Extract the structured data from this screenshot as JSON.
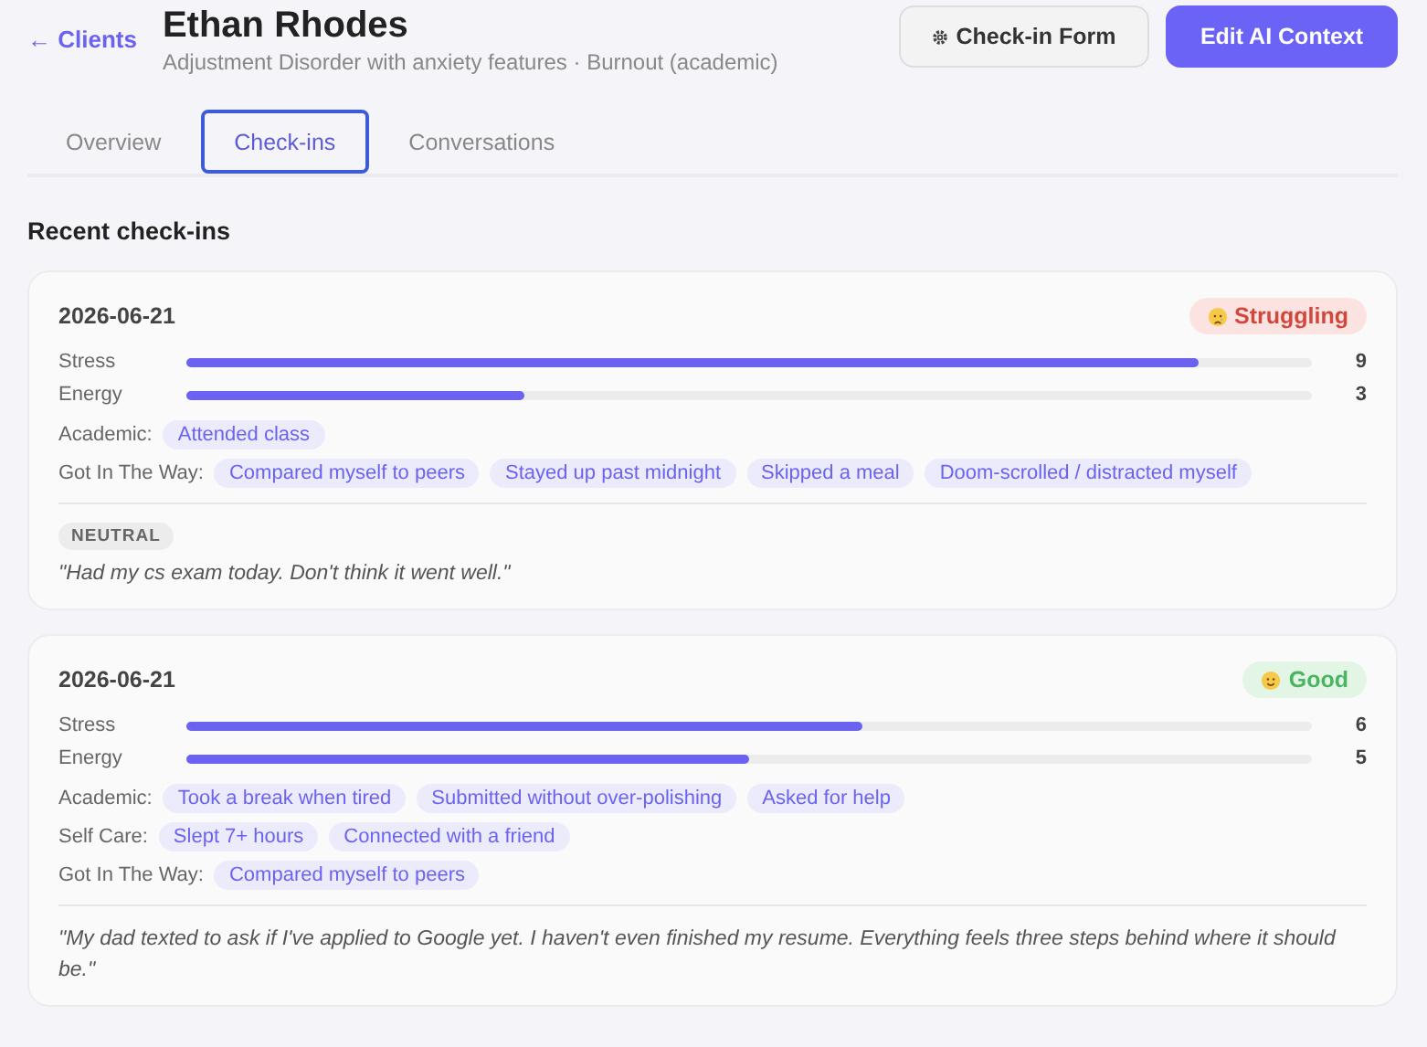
{
  "header": {
    "back_link": "← Clients",
    "client_name": "Ethan Rhodes",
    "subtitle": "Adjustment Disorder with anxiety features · Burnout (academic)",
    "buttons": [
      {
        "label": "Check-in Form",
        "kind": "secondary"
      },
      {
        "label": "Edit AI Context",
        "kind": "primary"
      }
    ]
  },
  "tabs": [
    {
      "label": "Overview",
      "selected": false
    },
    {
      "label": "Check-ins",
      "selected": true
    },
    {
      "label": "Conversations",
      "selected": false
    }
  ],
  "section_title": "Recent check-ins",
  "checkins": [
    {
      "date": "2026-06-21",
      "mood": {
        "label": "Struggling",
        "kind": "struggling"
      },
      "meters": [
        {
          "label": "Stress",
          "level": 0.9,
          "reading": "9"
        },
        {
          "label": "Energy",
          "level": 0.3,
          "reading": "3"
        }
      ],
      "tag_groups": [
        {
          "label": "Academic:",
          "tags": [
            "Attended class"
          ]
        },
        {
          "label": "Got In The Way:",
          "tags": [
            "Compared myself to peers",
            "Stayed up past midnight",
            "Skipped a meal",
            "Doom-scrolled / distracted myself"
          ]
        }
      ],
      "sentiment": "NEUTRAL",
      "note": "\"Had my cs exam today. Don't think it went well.\""
    },
    {
      "date": "2026-06-21",
      "mood": {
        "label": "Good",
        "kind": "good"
      },
      "meters": [
        {
          "label": "Stress",
          "level": 0.6,
          "reading": "6"
        },
        {
          "label": "Energy",
          "level": 0.5,
          "reading": "5"
        }
      ],
      "tag_groups": [
        {
          "label": "Academic:",
          "tags": [
            "Took a break when tired",
            "Submitted without over-polishing",
            "Asked for help"
          ]
        },
        {
          "label": "Self Care:",
          "tags": [
            "Slept 7+ hours",
            "Connected with a friend"
          ]
        },
        {
          "label": "Got In The Way:",
          "tags": [
            "Compared myself to peers"
          ]
        }
      ],
      "note": "\"My dad texted to ask if I've applied to Google yet. I haven't even finished my resume. Everything feels three steps behind where it should be.\""
    }
  ]
}
